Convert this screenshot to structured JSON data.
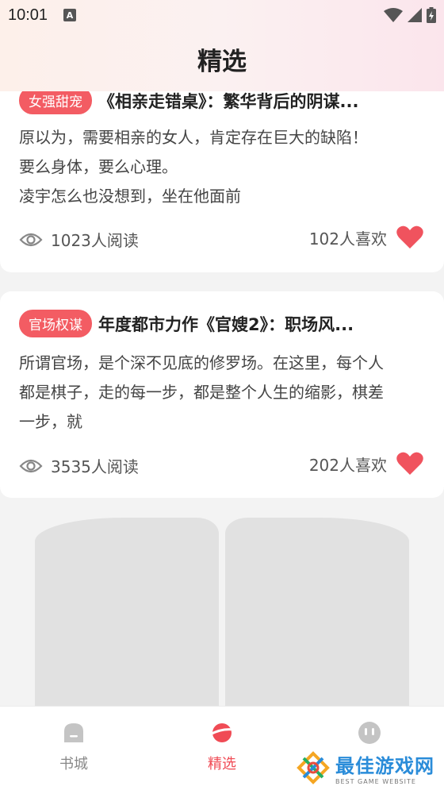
{
  "status_bar": {
    "time": "10:01",
    "notification_icon": "a-letter-icon",
    "wifi_icon": "wifi-icon",
    "signal_icon": "signal-icon",
    "battery_icon": "battery-charging-icon"
  },
  "header": {
    "title": "精选"
  },
  "articles": [
    {
      "tag": "女强甜宠",
      "title": "《相亲走错桌》：繁华背后的阴谋...",
      "excerpt": [
        "原以为，需要相亲的女人，肯定存在巨大的缺陷！",
        "要么身体，要么心理。",
        "凌宇怎么也没想到，坐在他面前"
      ],
      "reads": "1023人阅读",
      "likes": "102人喜欢"
    },
    {
      "tag": "官场权谋",
      "title": "年度都市力作《官嫂2》：职场风...",
      "excerpt": [
        "所谓官场，是个深不见底的修罗场。在这里，每个人",
        "都是棋子，走的每一步，都是整个人生的缩影，棋差",
        "一步，就"
      ],
      "reads": "3535人阅读",
      "likes": "202人喜欢"
    }
  ],
  "bottom_nav": {
    "items": [
      {
        "label": "书城",
        "icon": "bookstore-icon",
        "active": false
      },
      {
        "label": "精选",
        "icon": "planet-icon",
        "active": true
      },
      {
        "label": "",
        "icon": "profile-icon",
        "active": false
      }
    ]
  },
  "watermark": {
    "main": "最佳游戏网",
    "sub": "BEST GAME WEBSITE"
  },
  "colors": {
    "accent": "#f04b55",
    "tag_bg": "#f35c63",
    "heart": "#f0535e"
  }
}
